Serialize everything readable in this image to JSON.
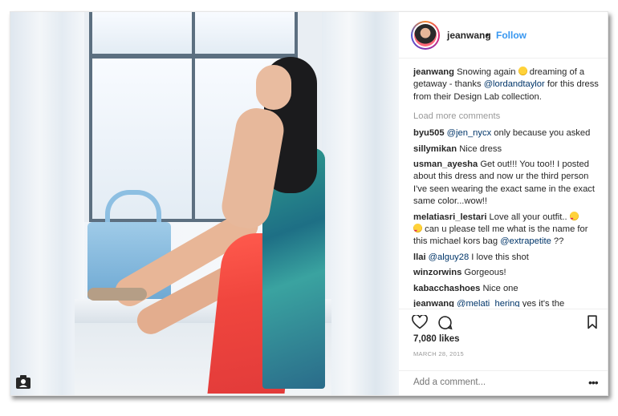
{
  "post": {
    "author": "jeanwang",
    "separator": "•",
    "follow_label": "Follow",
    "caption": {
      "user": "jeanwang",
      "text_before": "Snowing again ",
      "text_after": " dreaming of a getaway - thanks ",
      "mention": "@lordandtaylor",
      "text_end": " for this dress from their Design Lab collection."
    },
    "load_more": "Load more comments",
    "comments": [
      {
        "user": "byu505",
        "mention": "@jen_nycx",
        "text": " only because you asked"
      },
      {
        "user": "sillymikan",
        "mention": "",
        "text": "Nice dress"
      },
      {
        "user": "usman_ayesha",
        "mention": "",
        "text": "Get out!!! You too!! I posted about this dress and now ur the third person I've seen wearing the exact same in the exact same color...wow!!"
      },
      {
        "user": "melatiasri_lestari",
        "mention": "",
        "text": "Love all your outfit.. ",
        "text2": " can u please tell me what is the name for this michael kors bag ",
        "mention2": "@extrapetite",
        "text3": " ??"
      },
      {
        "user": "llai",
        "mention": "@alguy28",
        "text": " I love this shot"
      },
      {
        "user": "winzorwins",
        "mention": "",
        "text": "Gorgeous!"
      },
      {
        "user": "kabacchashoes",
        "mention": "",
        "text": "Nice one"
      },
      {
        "user": "jeanwang",
        "mention": "@melati_hering",
        "text": " yes it's the"
      }
    ],
    "likes": "7,080 likes",
    "date": "MARCH 28, 2015",
    "add_comment_placeholder": "Add a comment...",
    "more_label": "•••"
  },
  "icons": [
    "heart-icon",
    "comment-icon",
    "bookmark-icon",
    "user-tag-icon"
  ]
}
